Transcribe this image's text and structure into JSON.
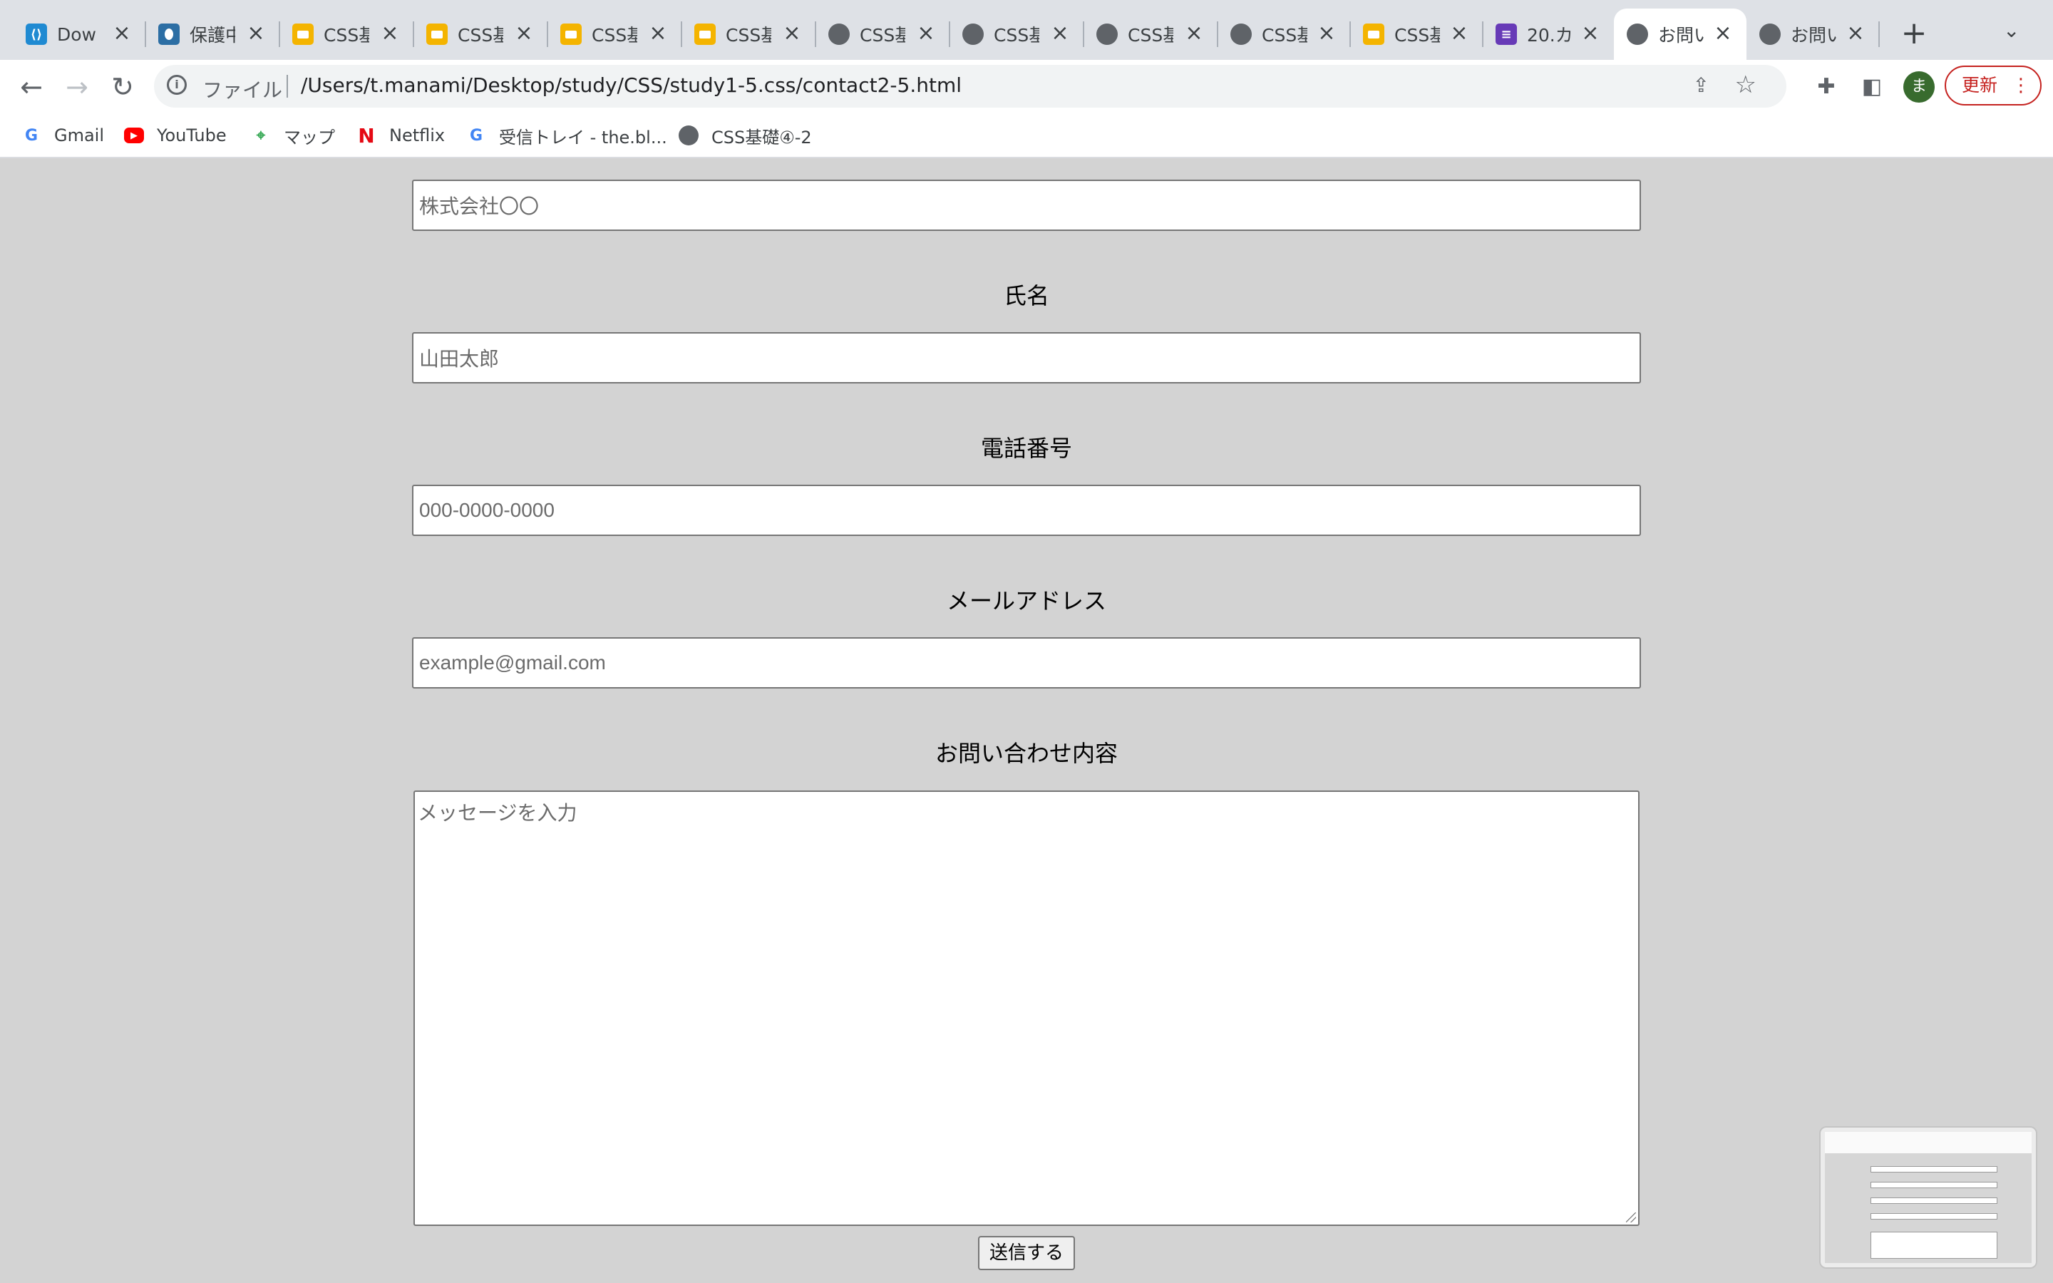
{
  "browser": {
    "tabs": [
      {
        "title": "Dow",
        "icon": "vscode-icon"
      },
      {
        "title": "保護中",
        "icon": "shield-icon"
      },
      {
        "title": "CSS基",
        "icon": "slides-icon"
      },
      {
        "title": "CSS基",
        "icon": "slides-icon"
      },
      {
        "title": "CSS基",
        "icon": "slides-icon"
      },
      {
        "title": "CSS基",
        "icon": "slides-icon"
      },
      {
        "title": "CSS基",
        "icon": "globe-icon"
      },
      {
        "title": "CSS基",
        "icon": "globe-icon"
      },
      {
        "title": "CSS基",
        "icon": "globe-icon"
      },
      {
        "title": "CSS基",
        "icon": "globe-icon"
      },
      {
        "title": "CSS基",
        "icon": "slides-icon"
      },
      {
        "title": "20.カ",
        "icon": "forms-icon"
      },
      {
        "title": "お問い",
        "icon": "globe-icon",
        "active": true
      },
      {
        "title": "お問い",
        "icon": "globe-icon"
      }
    ],
    "address": {
      "scheme_label": "ファイル",
      "url": "/Users/t.manami/Desktop/study/CSS/study1-5.css/contact2-5.html"
    },
    "profile_initial": "ま",
    "update_label": "更新",
    "bookmarks": [
      {
        "label": "Gmail",
        "icon": "google-icon"
      },
      {
        "label": "YouTube",
        "icon": "youtube-icon"
      },
      {
        "label": "マップ",
        "icon": "maps-icon"
      },
      {
        "label": "Netflix",
        "icon": "netflix-icon"
      },
      {
        "label": "受信トレイ - the.bl...",
        "icon": "google-icon"
      },
      {
        "label": "CSS基礎④-2",
        "icon": "globe-icon"
      }
    ]
  },
  "form": {
    "company": {
      "placeholder": "株式会社〇〇"
    },
    "name": {
      "label": "氏名",
      "placeholder": "山田太郎"
    },
    "phone": {
      "label": "電話番号",
      "placeholder": "000-0000-0000"
    },
    "email": {
      "label": "メールアドレス",
      "placeholder": "example@gmail.com"
    },
    "message": {
      "label": "お問い合わせ内容",
      "placeholder": "メッセージを入力"
    },
    "submit_label": "送信する"
  },
  "colors": {
    "page_background": "#d3d3d3",
    "update_button": "#c5221f",
    "profile_avatar": "#386b2e"
  }
}
